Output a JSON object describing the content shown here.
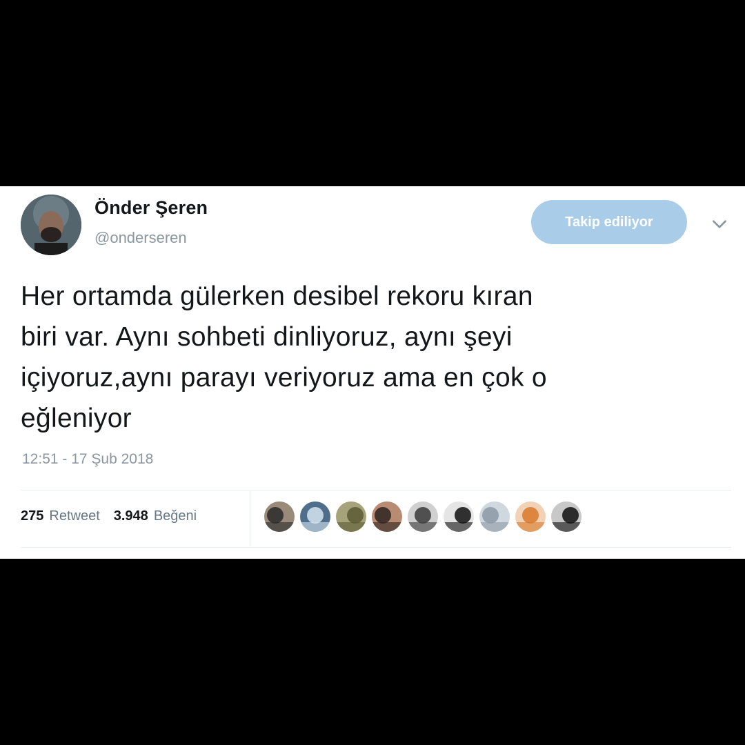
{
  "tweet": {
    "author": {
      "display_name": "Önder Şeren",
      "handle": "@onderseren"
    },
    "follow_button_label": "Takip ediliyor",
    "text_lines": [
      "Her ortamda gülerken desibel rekoru kıran",
      "biri var. Aynı sohbeti dinliyoruz, aynı şeyi",
      "içiyoruz,aynı parayı veriyoruz ama en çok o",
      "eğleniyor"
    ],
    "timestamp": "12:51 - 17 Şub 2018",
    "stats": {
      "retweet_count": "275",
      "retweet_label": "Retweet",
      "like_count": "3.948",
      "like_label": "Beğeni"
    },
    "liker_avatars": [
      {
        "name": "liker-1",
        "colors": [
          "#2a2a2a",
          "#9a8a7a"
        ]
      },
      {
        "name": "liker-2",
        "colors": [
          "#d5e4ef",
          "#4f6e8c"
        ]
      },
      {
        "name": "liker-3",
        "colors": [
          "#5b5a34",
          "#a6a27a"
        ]
      },
      {
        "name": "liker-4",
        "colors": [
          "#2d2320",
          "#b98b73"
        ]
      },
      {
        "name": "liker-5",
        "colors": [
          "#3a3a3a",
          "#d0d0d0"
        ]
      },
      {
        "name": "liker-6",
        "colors": [
          "#111111",
          "#e5e5e5"
        ]
      },
      {
        "name": "liker-7",
        "colors": [
          "#8c9aa7",
          "#cfd8de"
        ]
      },
      {
        "name": "liker-8",
        "colors": [
          "#d9792a",
          "#f1d2b6"
        ]
      },
      {
        "name": "liker-9",
        "colors": [
          "#0f0f0f",
          "#c8c8c8"
        ]
      }
    ]
  },
  "colors": {
    "background": "#000000",
    "card": "#ffffff",
    "text": "#14171a",
    "muted": "#8a96a0",
    "follow_button": "#a9cde9",
    "divider": "#e6ecf0"
  },
  "icons": {
    "chevron": "chevron-down-icon"
  }
}
